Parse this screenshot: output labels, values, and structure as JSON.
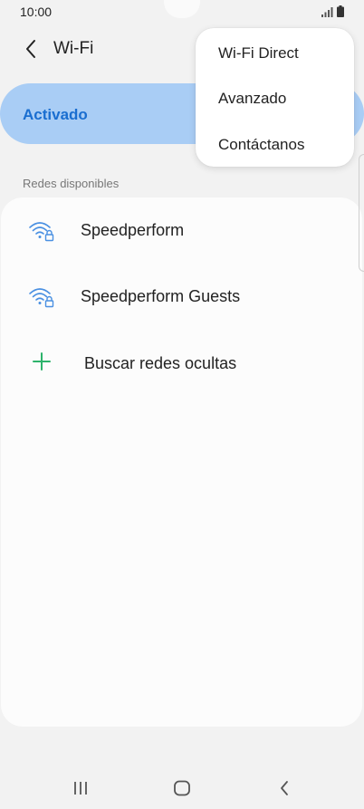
{
  "status_bar": {
    "time": "10:00"
  },
  "header": {
    "title": "Wi-Fi"
  },
  "master_toggle": {
    "label": "Activado"
  },
  "section": {
    "title": "Redes disponibles"
  },
  "networks": [
    {
      "name": "Speedperform",
      "icon": "wifi-lock-icon"
    },
    {
      "name": "Speedperform Guests",
      "icon": "wifi-lock-icon"
    }
  ],
  "add_network": {
    "label": "Buscar redes ocultas",
    "icon": "plus-icon"
  },
  "overflow_menu": {
    "items": [
      {
        "label": "Wi-Fi Direct"
      },
      {
        "label": "Avanzado"
      },
      {
        "label": "Contáctanos"
      }
    ]
  },
  "nav_bar": {
    "buttons": [
      "recents-icon",
      "home-icon",
      "back-icon"
    ]
  },
  "colors": {
    "accent": "#1a6ed0",
    "toggle_bg": "#a9cdf5",
    "wifi_icon": "#4a90e2",
    "plus_icon": "#2db36b"
  }
}
